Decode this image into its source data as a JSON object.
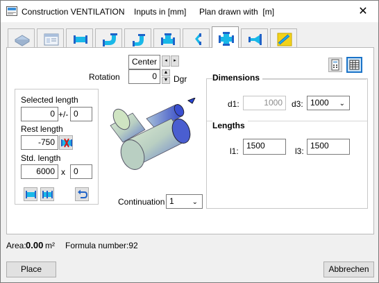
{
  "window": {
    "title": "Construction VENTILATION",
    "inputs_info": "Inputs in [mm]",
    "plan_info": "Plan drawn with  [m]",
    "close_glyph": "✕"
  },
  "tabs": [
    {
      "icon": "flat-duct-icon",
      "active": false
    },
    {
      "icon": "table-icon",
      "active": false
    },
    {
      "icon": "straight-duct-icon",
      "active": false
    },
    {
      "icon": "bend-icon",
      "active": false
    },
    {
      "icon": "offset-bend-icon",
      "active": false
    },
    {
      "icon": "tee-icon",
      "active": false
    },
    {
      "icon": "wye-icon",
      "active": false
    },
    {
      "icon": "cross-icon",
      "active": true
    },
    {
      "icon": "reducer-icon",
      "active": false
    },
    {
      "icon": "flexible-duct-icon",
      "active": false
    }
  ],
  "rotation": {
    "label": "Rotation",
    "position": "Center",
    "value": "0",
    "unit": "Dgr",
    "left_arrow": "◂",
    "right_arrow": "▸",
    "up_arrow": "▲",
    "down_arrow": "▼"
  },
  "lengths_box": {
    "selected_label": "Selected length",
    "selected_value": "0",
    "tolerance_label": "+/-",
    "tolerance_value": "0",
    "rest_label": "Rest length",
    "rest_value": "-750",
    "std_label": "Std. length",
    "std_value": "6000",
    "times_label": "x",
    "std_count": "0"
  },
  "dimensions": {
    "title": "Dimensions",
    "d1_label": "d1:",
    "d1_value": "1000",
    "d3_label": "d3:",
    "d3_value": "1000"
  },
  "lengths": {
    "title": "Lengths",
    "l1_label": "l1:",
    "l1_value": "1500",
    "l3_label": "l3:",
    "l3_value": "1500"
  },
  "continuation": {
    "label": "Continuation",
    "value": "1"
  },
  "status": {
    "area_label": "Area:",
    "area_value": "0.00",
    "area_unit": "m²",
    "formula": "Formula number:92"
  },
  "buttons": {
    "place": "Place",
    "cancel": "Abbrechen"
  },
  "colors": {
    "duct_blue": "#1f63c8",
    "duct_cyan": "#19b8e8",
    "fitting_body": "#c7dcc0",
    "pencil_yellow": "#f2d21a"
  }
}
